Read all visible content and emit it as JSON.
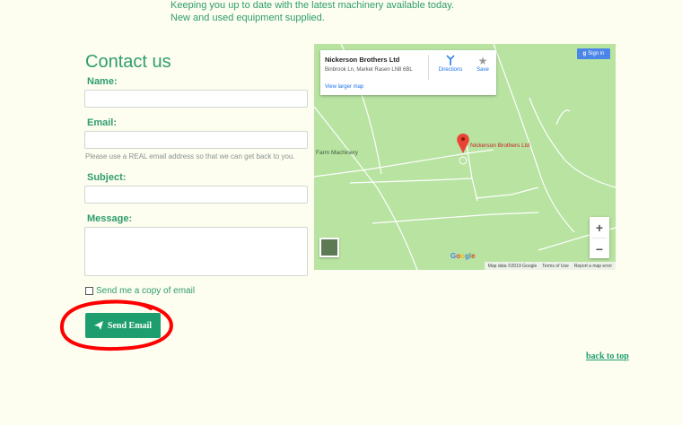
{
  "intro": {
    "line1": "Keeping you up to date with the latest machinery available today.",
    "line2": "New and used equipment supplied."
  },
  "form": {
    "title": "Contact us",
    "name_label": "Name:",
    "email_label": "Email:",
    "email_hint": "Please use a REAL email address so that we can get back to you.",
    "subject_label": "Subject:",
    "message_label": "Message:",
    "copy_label": "Send me a copy of email",
    "copy_checked": false,
    "send_label": "Send Email"
  },
  "map": {
    "card_title": "Nickerson Brothers Ltd",
    "card_address": "Binbrook Ln, Market Rasen LN8 6BL",
    "directions_label": "Directions",
    "save_label": "Save",
    "larger_map_label": "View larger map",
    "signin_label": "Sign in",
    "pin_label": "Nickerson Brothers Ltd",
    "place_label": "Farm Machinery",
    "zoom_in": "+",
    "zoom_out": "−",
    "google_logo": "Google",
    "map_data": "Map data ©2019 Google",
    "terms": "Terms of Use",
    "report": "Report a map error"
  },
  "footer": {
    "back_to_top": "back to top"
  },
  "colors": {
    "brand_green": "#2e9d6e",
    "button_green": "#1e9e6e",
    "annotation_red": "#ff0000",
    "map_green": "#b8e3a1"
  }
}
